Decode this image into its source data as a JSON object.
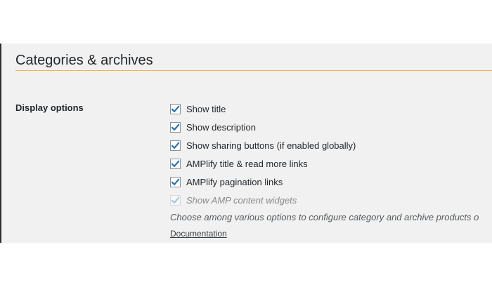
{
  "section": {
    "title": "Categories & archives"
  },
  "field": {
    "label": "Display options",
    "options": [
      {
        "label": "Show title",
        "checked": true,
        "disabled": false
      },
      {
        "label": "Show description",
        "checked": true,
        "disabled": false
      },
      {
        "label": "Show sharing buttons (if enabled globally)",
        "checked": true,
        "disabled": false
      },
      {
        "label": "AMPlify title & read more links",
        "checked": true,
        "disabled": false
      },
      {
        "label": "AMPlify pagination links",
        "checked": true,
        "disabled": false
      },
      {
        "label": "Show AMP content widgets",
        "checked": true,
        "disabled": true
      }
    ],
    "description": "Choose among various options to configure category and archive products o",
    "doc_link": "Documentation"
  },
  "colors": {
    "accent_rule": "#f0b64a",
    "check": "#2271b1",
    "check_disabled": "#a7c6dc"
  }
}
